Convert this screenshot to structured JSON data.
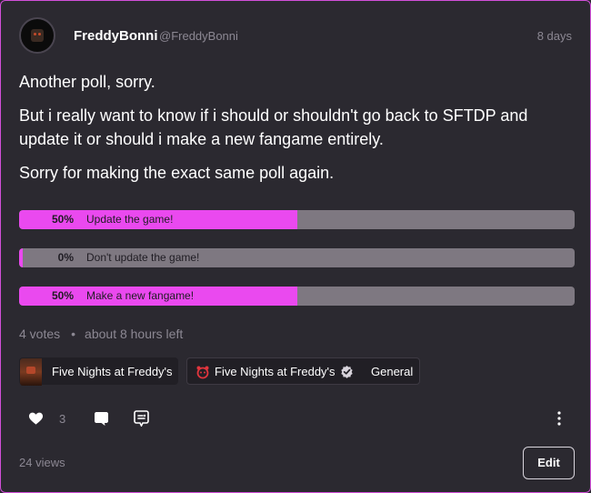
{
  "post": {
    "author": {
      "display_name": "FreddyBonni",
      "handle": "@FreddyBonni",
      "avatar_icon": "freddy-avatar"
    },
    "timestamp": "8 days",
    "paragraphs": [
      "Another poll, sorry.",
      "But i really want to know if i should or shouldn't go back to SFTDP and update it or should i make a new fangame entirely.",
      "Sorry for making the exact same poll again."
    ],
    "poll": {
      "options": [
        {
          "percent": "50%",
          "fill": 50,
          "label": "Update the game!"
        },
        {
          "percent": "0%",
          "fill": 0,
          "label": "Don't update the game!"
        },
        {
          "percent": "50%",
          "fill": 50,
          "label": "Make a new fangame!"
        }
      ],
      "votes": "4 votes",
      "time_left": "about 8 hours left"
    },
    "tags": [
      {
        "label": "Five Nights at Freddy's",
        "icon": "fnaf-thumbnail"
      },
      {
        "label": "Five Nights at Freddy's",
        "icon": "fnaf-red-icon",
        "verified_icon": "verified-badge-icon",
        "sub_label": "General"
      }
    ],
    "actions": {
      "like_count": "3",
      "like_icon": "heart-icon",
      "comment_icon": "comment-icon",
      "share_icon": "share-icon",
      "more_icon": "more-vertical-icon"
    },
    "views": "24 views",
    "edit_label": "Edit"
  },
  "colors": {
    "background": "#2b2930",
    "accent": "#ea49ef",
    "border": "#d24fd9",
    "poll_track": "#7e7881",
    "muted_text": "#8c8893"
  }
}
